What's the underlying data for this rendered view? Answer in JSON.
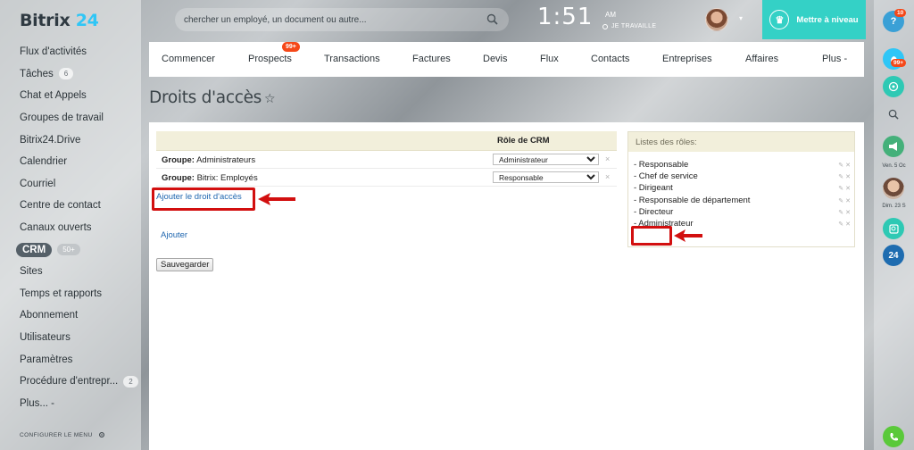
{
  "app": {
    "logo_text": "Bitrix",
    "logo_number": "24"
  },
  "sidebar": {
    "items": [
      {
        "label": "Flux d'activités"
      },
      {
        "label": "Tâches",
        "badge": "6"
      },
      {
        "label": "Chat et Appels"
      },
      {
        "label": "Groupes de travail"
      },
      {
        "label": "Bitrix24.Drive"
      },
      {
        "label": "Calendrier"
      },
      {
        "label": "Courriel"
      },
      {
        "label": "Centre de contact"
      },
      {
        "label": "Canaux ouverts"
      },
      {
        "label": "CRM",
        "badge": "50+",
        "active": true
      },
      {
        "label": "Sites"
      },
      {
        "label": "Temps et rapports"
      },
      {
        "label": "Abonnement"
      },
      {
        "label": "Utilisateurs"
      },
      {
        "label": "Paramètres"
      },
      {
        "label": "Procédure d'entrepr...",
        "badge": "2"
      },
      {
        "label": "Plus... -"
      }
    ],
    "configure_label": "CONFIGURER LE MENU"
  },
  "header": {
    "search_placeholder": "chercher un employé, un document ou autre...",
    "clock": "1:51",
    "ampm": "AM",
    "work_status": "JE TRAVAILLE",
    "upgrade_label": "Mettre à niveau"
  },
  "tabs": [
    {
      "label": "Commencer"
    },
    {
      "label": "Prospects",
      "counter": "99+"
    },
    {
      "label": "Transactions"
    },
    {
      "label": "Factures"
    },
    {
      "label": "Devis"
    },
    {
      "label": "Flux"
    },
    {
      "label": "Contacts"
    },
    {
      "label": "Entreprises"
    },
    {
      "label": "Affaires"
    },
    {
      "label": "Plus -"
    }
  ],
  "page": {
    "title": "Droits d'accès",
    "star": "☆"
  },
  "permissions": {
    "role_column_header": "Rôle de CRM",
    "group_prefix": "Groupe:",
    "rows": [
      {
        "group": "Administrateurs",
        "role": "Administrateur"
      },
      {
        "group": "Bitrix: Employés",
        "role": "Responsable"
      }
    ],
    "add_right_label": "Ajouter le droit d'accès",
    "save_label": "Sauvegarder"
  },
  "roles": {
    "header": "Listes des rôles:",
    "items": [
      "- Responsable",
      "- Chef de service",
      "- Dirigeant",
      "- Responsable de département",
      "- Directeur",
      "- Administrateur"
    ],
    "add_label": "Ajouter"
  },
  "rail": {
    "help_badge": "10",
    "notif_badge": "99+",
    "date1": "Ven. 5 Oc",
    "date2": "Dim. 23 S",
    "b24_label": "24"
  },
  "colors": {
    "accent_teal": "#34d1c6",
    "badge_red": "#f54819",
    "link_blue": "#2067b0",
    "highlight_red": "#d20f0f"
  }
}
